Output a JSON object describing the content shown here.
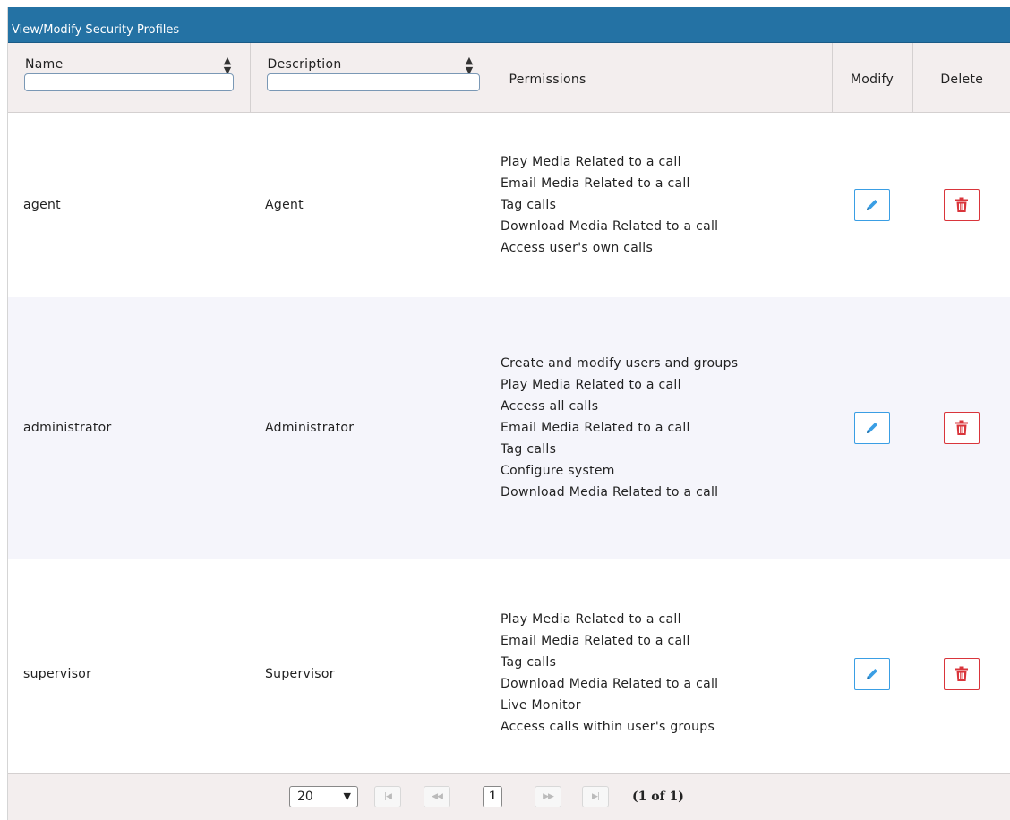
{
  "panel": {
    "title": "View/Modify Security Profiles"
  },
  "columns": {
    "name": "Name",
    "description": "Description",
    "permissions": "Permissions",
    "modify": "Modify",
    "delete": "Delete",
    "sort_icon": "sort-icon"
  },
  "filters": {
    "name_value": "",
    "description_value": ""
  },
  "rows": [
    {
      "name": "agent",
      "description": "Agent",
      "permissions": [
        "Play Media Related to a call",
        "Email Media Related to a call",
        "Tag calls",
        "Download Media Related to a call",
        "Access user's own calls"
      ]
    },
    {
      "name": "administrator",
      "description": "Administrator",
      "permissions": [
        "Create and modify users and groups",
        "Play Media Related to a call",
        "Access all calls",
        "Email Media Related to a call",
        "Tag calls",
        "Configure system",
        "Download Media Related to a call"
      ]
    },
    {
      "name": "supervisor",
      "description": "Supervisor",
      "permissions": [
        "Play Media Related to a call",
        "Email Media Related to a call",
        "Tag calls",
        "Download Media Related to a call",
        "Live Monitor",
        "Access calls within user's groups"
      ]
    }
  ],
  "icons": {
    "modify": "pencil-icon",
    "delete": "trash-icon"
  },
  "colors": {
    "header_bar": "#2472a4",
    "modify_accent": "#3a9ee4",
    "delete_accent": "#d9353b",
    "alt_row": "#f5f5fb",
    "column_header_bg": "#f3eeee"
  },
  "pager": {
    "rows_per_page": "20",
    "current_page": "1",
    "status": "(1 of 1)"
  }
}
